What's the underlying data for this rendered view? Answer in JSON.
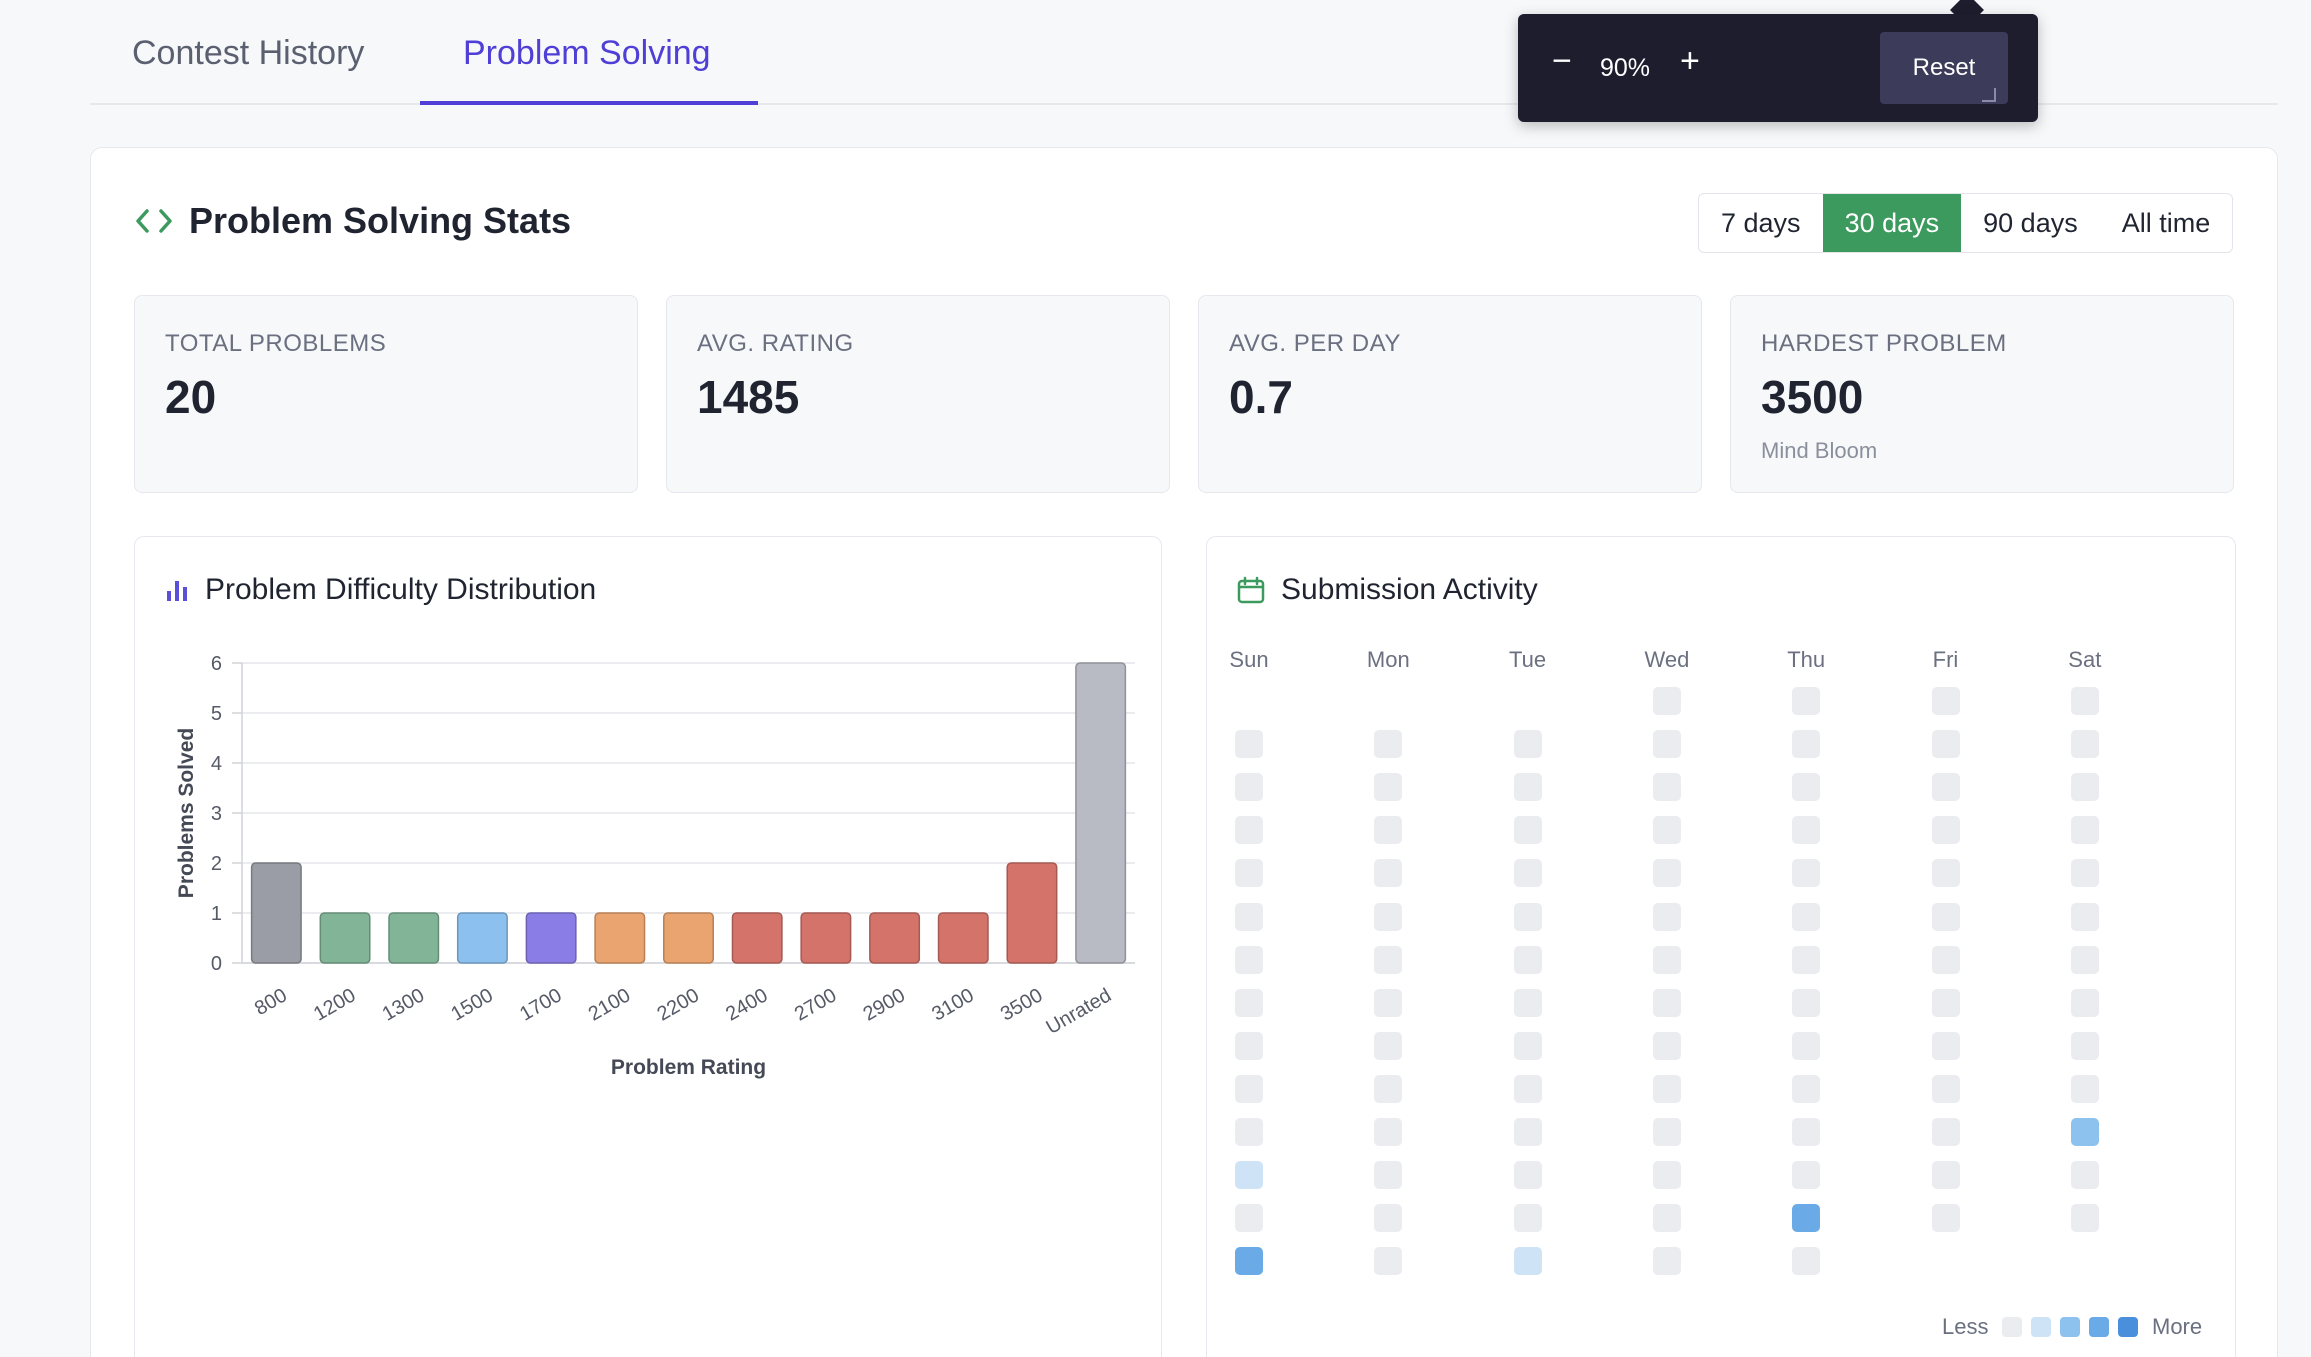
{
  "tabs": [
    {
      "label": "Contest History",
      "active": false
    },
    {
      "label": "Problem Solving",
      "active": true
    }
  ],
  "zoom": {
    "minus": "−",
    "level": "90%",
    "plus": "+",
    "reset": "Reset"
  },
  "stats_header": {
    "title": "Problem Solving Stats"
  },
  "range_options": [
    {
      "label": "7 days",
      "active": false
    },
    {
      "label": "30 days",
      "active": true
    },
    {
      "label": "90 days",
      "active": false
    },
    {
      "label": "All time",
      "active": false
    }
  ],
  "stat_cards": [
    {
      "label": "TOTAL PROBLEMS",
      "value": "20",
      "sub": ""
    },
    {
      "label": "AVG. RATING",
      "value": "1485",
      "sub": ""
    },
    {
      "label": "AVG. PER DAY",
      "value": "0.7",
      "sub": ""
    },
    {
      "label": "HARDEST PROBLEM",
      "value": "3500",
      "sub": "Mind Bloom"
    }
  ],
  "difficulty_panel": {
    "title": "Problem Difficulty Distribution"
  },
  "activity_panel": {
    "title": "Submission Activity"
  },
  "chart_data": {
    "type": "bar",
    "categories": [
      "800",
      "1200",
      "1300",
      "1500",
      "1700",
      "2100",
      "2200",
      "2400",
      "2700",
      "2900",
      "3100",
      "3500",
      "Unrated"
    ],
    "values": [
      2,
      1,
      1,
      1,
      1,
      1,
      1,
      1,
      1,
      1,
      1,
      2,
      6
    ],
    "colors": [
      "#9a9ca6",
      "#82b597",
      "#82b597",
      "#8cc0ee",
      "#8a7de6",
      "#eaa470",
      "#eaa470",
      "#d4736a",
      "#d4736a",
      "#d4736a",
      "#d4736a",
      "#d4736a",
      "#b8bac4"
    ],
    "xlabel": "Problem Rating",
    "ylabel": "Problems Solved",
    "ylim": [
      0,
      6
    ],
    "yticks": [
      "0",
      "1",
      "2",
      "3",
      "4",
      "5",
      "6"
    ],
    "grid": true
  },
  "heatmap": {
    "days": [
      "Sun",
      "Mon",
      "Tue",
      "Wed",
      "Thu",
      "Fri",
      "Sat"
    ],
    "rows": [
      [
        null,
        null,
        null,
        0,
        0,
        0,
        0
      ],
      [
        0,
        0,
        0,
        0,
        0,
        0,
        0
      ],
      [
        0,
        0,
        0,
        0,
        0,
        0,
        0
      ],
      [
        0,
        0,
        0,
        0,
        0,
        0,
        0
      ],
      [
        0,
        0,
        0,
        0,
        0,
        0,
        0
      ],
      [
        0,
        0,
        0,
        0,
        0,
        0,
        0
      ],
      [
        0,
        0,
        0,
        0,
        0,
        0,
        0
      ],
      [
        0,
        0,
        0,
        0,
        0,
        0,
        0
      ],
      [
        0,
        0,
        0,
        0,
        0,
        0,
        0
      ],
      [
        0,
        0,
        0,
        0,
        0,
        0,
        0
      ],
      [
        0,
        0,
        0,
        0,
        0,
        0,
        2
      ],
      [
        1,
        0,
        0,
        0,
        0,
        0,
        0
      ],
      [
        0,
        0,
        0,
        0,
        3,
        0,
        0
      ],
      [
        3,
        0,
        1,
        0,
        0,
        null,
        null
      ]
    ],
    "level_colors": [
      "#ebecf0",
      "#cfe3f7",
      "#8ec2ee",
      "#6aaae6",
      "#4a8fdc"
    ],
    "less": "Less",
    "more": "More"
  }
}
